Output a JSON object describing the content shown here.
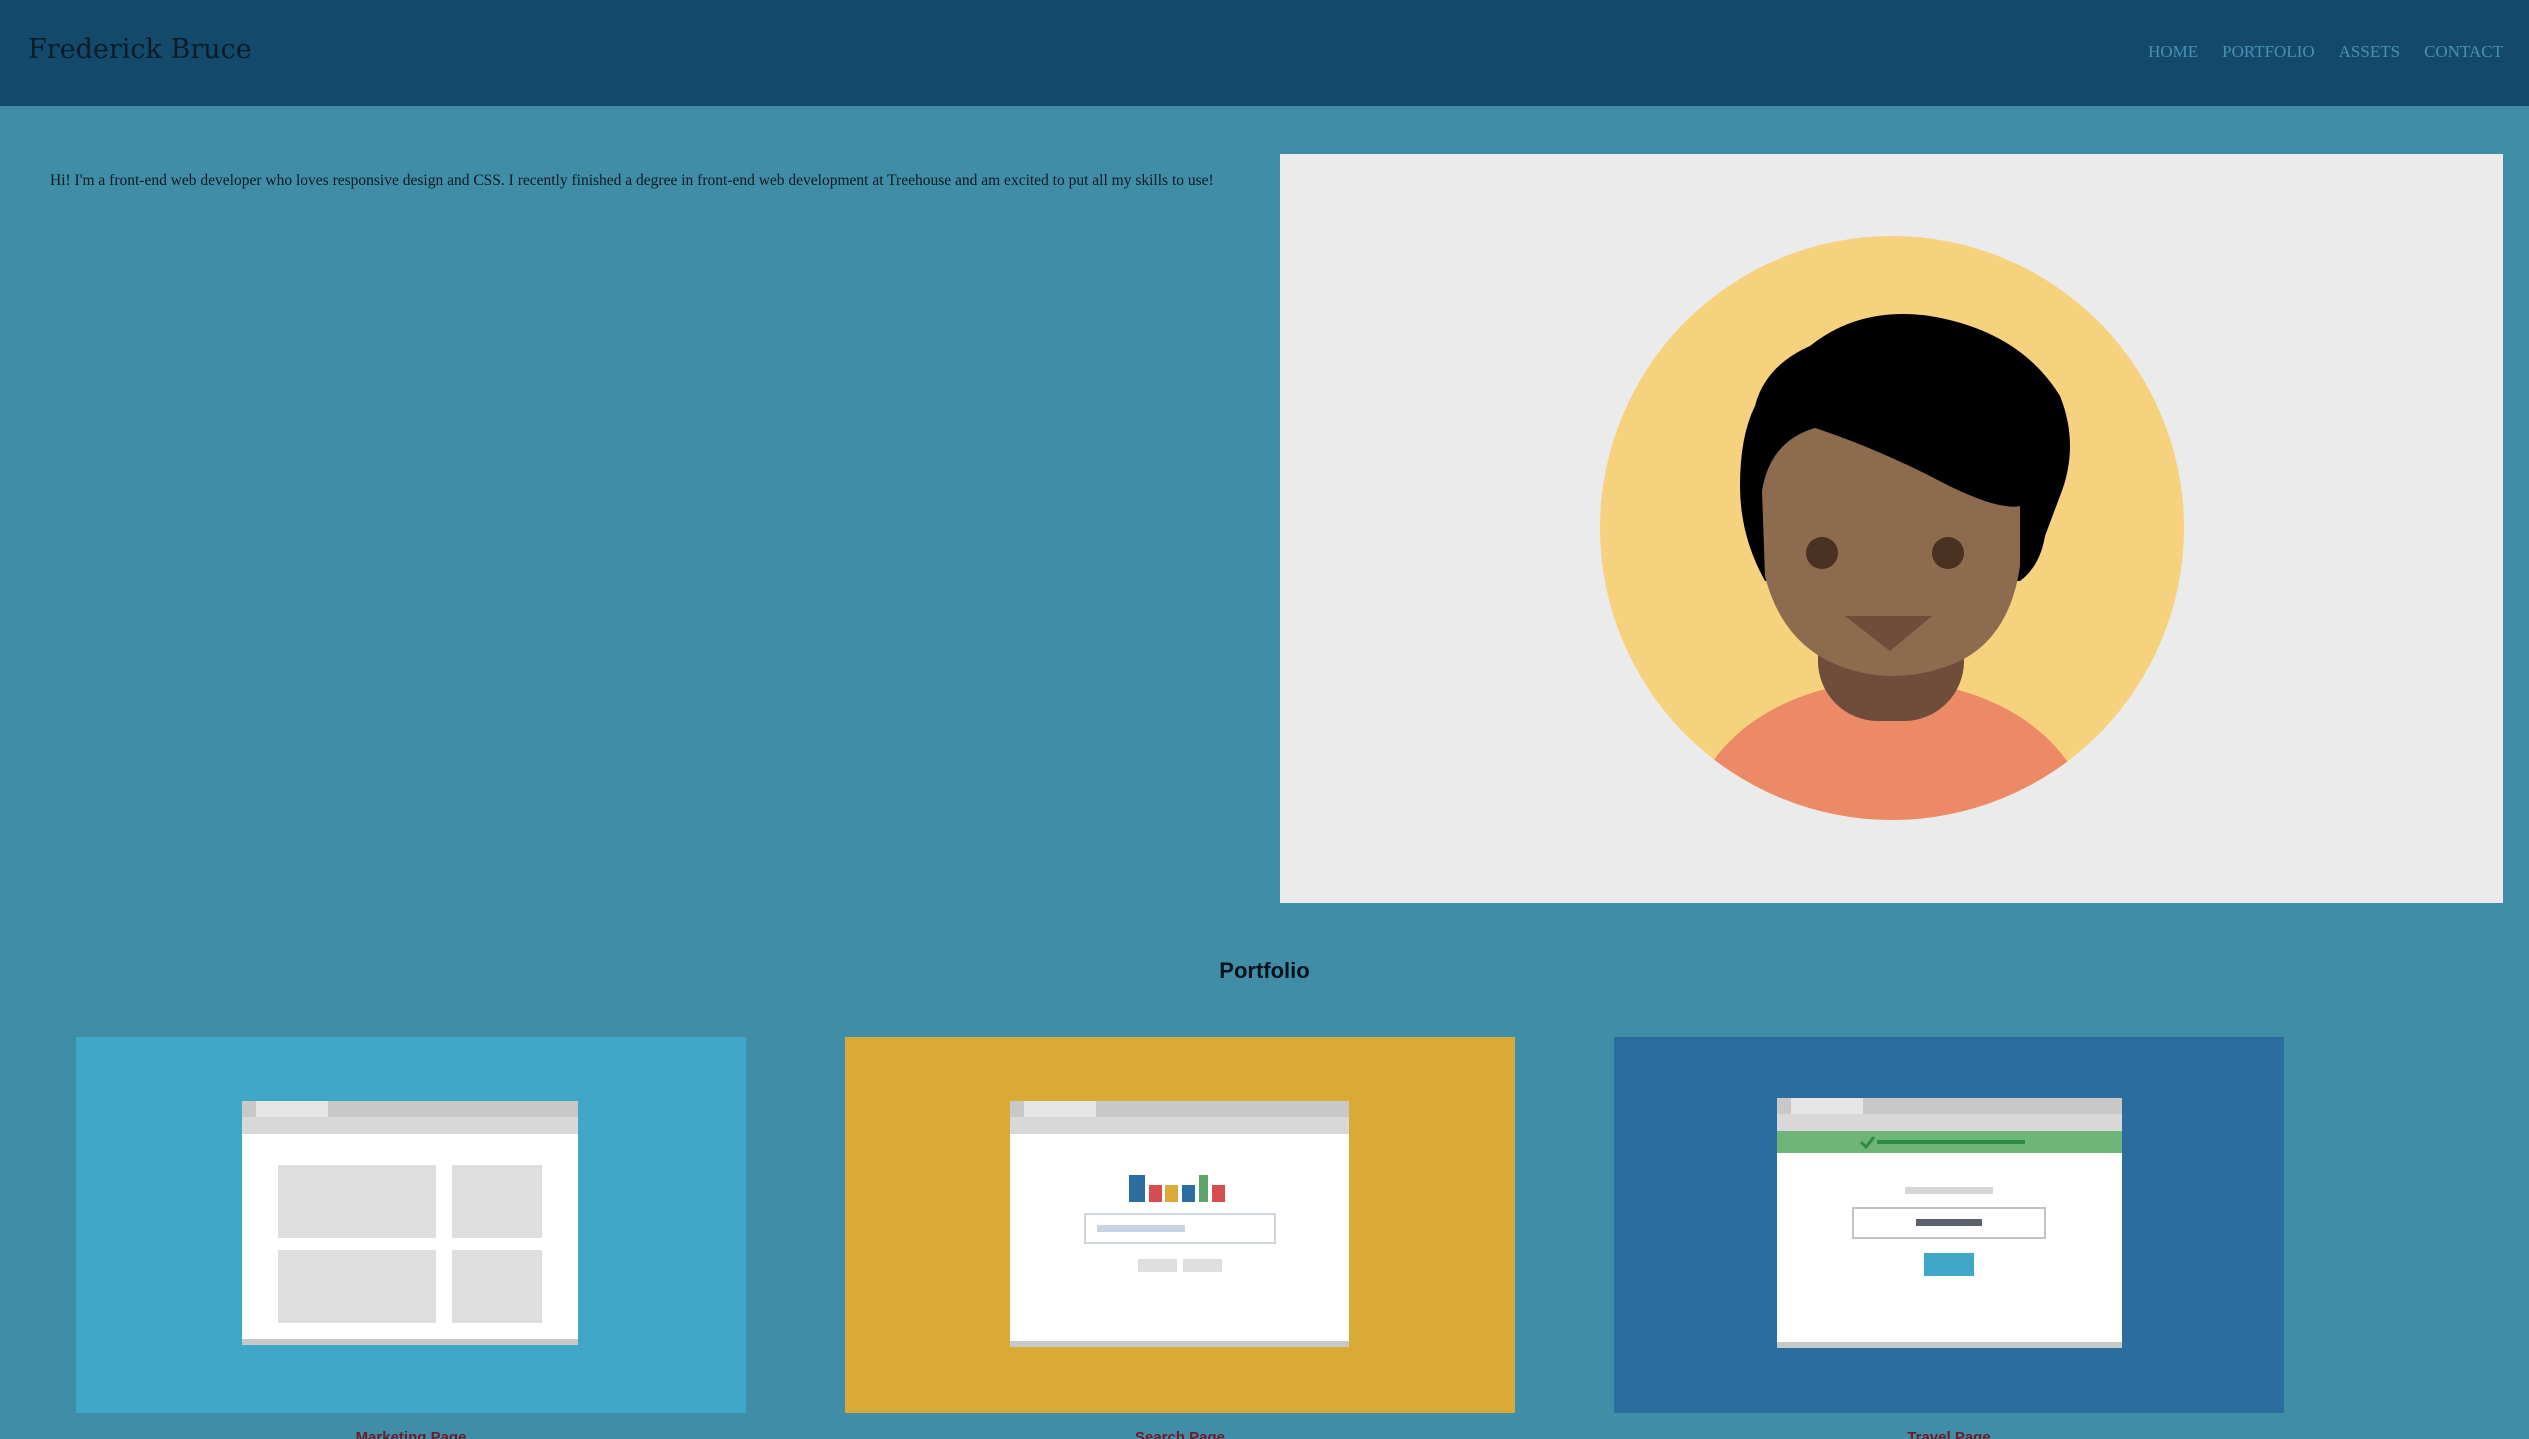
{
  "header": {
    "brand": "Frederick Bruce",
    "nav": [
      "HOME",
      "PORTFOLIO",
      "ASSETS",
      "CONTACT"
    ]
  },
  "intro": {
    "text": "Hi! I'm a front-end web developer who loves responsive design and CSS. I recently finished a degree in front-end web development at Treehouse and am excited to put all my skills to use!"
  },
  "avatar": {
    "icon": "avatar-illustration-icon"
  },
  "portfolio": {
    "heading": "Portfolio",
    "items": [
      {
        "caption": "Marketing Page",
        "color": "#41a7c9",
        "icon": "marketing-page-thumbnail-icon"
      },
      {
        "caption": "Search Page",
        "color": "#d9aa37",
        "icon": "search-page-thumbnail-icon"
      },
      {
        "caption": "Travel Page",
        "color": "#2c6da0",
        "icon": "travel-page-thumbnail-icon"
      }
    ]
  },
  "colors": {
    "header_bg": "#134a6c",
    "page_bg": "#3f8da6",
    "nav_link": "#4a8fb3"
  }
}
